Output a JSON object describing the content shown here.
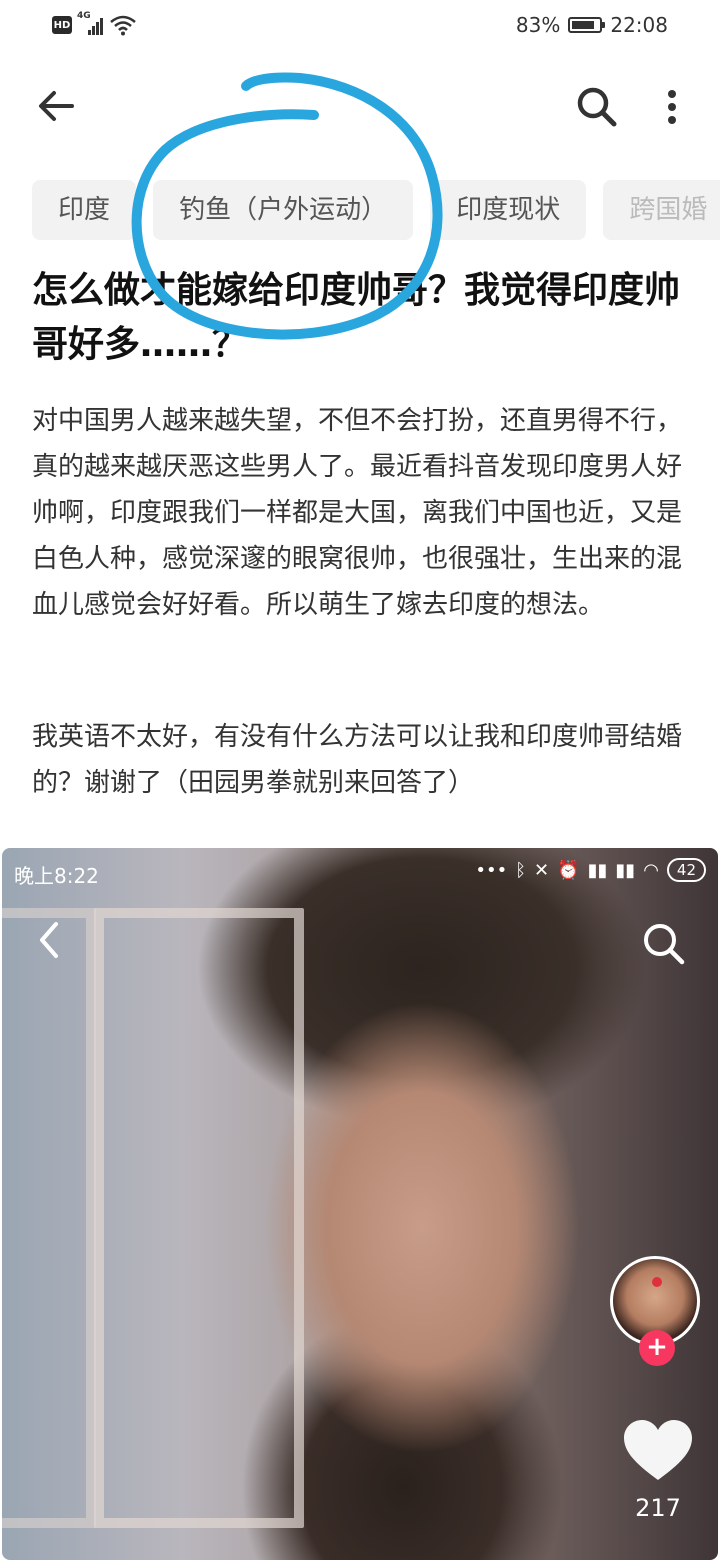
{
  "status_bar": {
    "hd_label": "HD",
    "network_label": "4G",
    "battery_percent_text": "83%",
    "battery_level": 0.83,
    "time": "22:08"
  },
  "nav": {
    "back_icon": "arrow-left-icon",
    "search_icon": "search-icon",
    "more_icon": "more-vertical-icon"
  },
  "tags": [
    "印度",
    "钓鱼（户外运动）",
    "印度现状",
    "跨国婚"
  ],
  "question": {
    "title": "怎么做才能嫁给印度帅哥？我觉得印度帅哥好多……？",
    "paragraph1": "对中国男人越来越失望，不但不会打扮，还直男得不行，真的越来越厌恶这些男人了。最近看抖音发现印度男人好帅啊，印度跟我们一样都是大国，离我们中国也近，又是白色人种，感觉深邃的眼窝很帅，也很强壮，生出来的混血儿感觉会好好看。所以萌生了嫁去印度的想法。",
    "paragraph2": "我英语不太好，有没有什么方法可以让我和印度帅哥结婚的？谢谢了（田园男拳就别来回答了）"
  },
  "annotation": {
    "color": "#2aa6df",
    "shape": "hand-drawn-circle"
  },
  "embedded_screenshot": {
    "time": "晚上8:22",
    "battery": "42",
    "back_icon": "chevron-left-icon",
    "search_icon": "search-icon",
    "follow_label": "+",
    "like_count": "217",
    "like_icon": "heart-icon",
    "accent_color": "#f7375f"
  }
}
